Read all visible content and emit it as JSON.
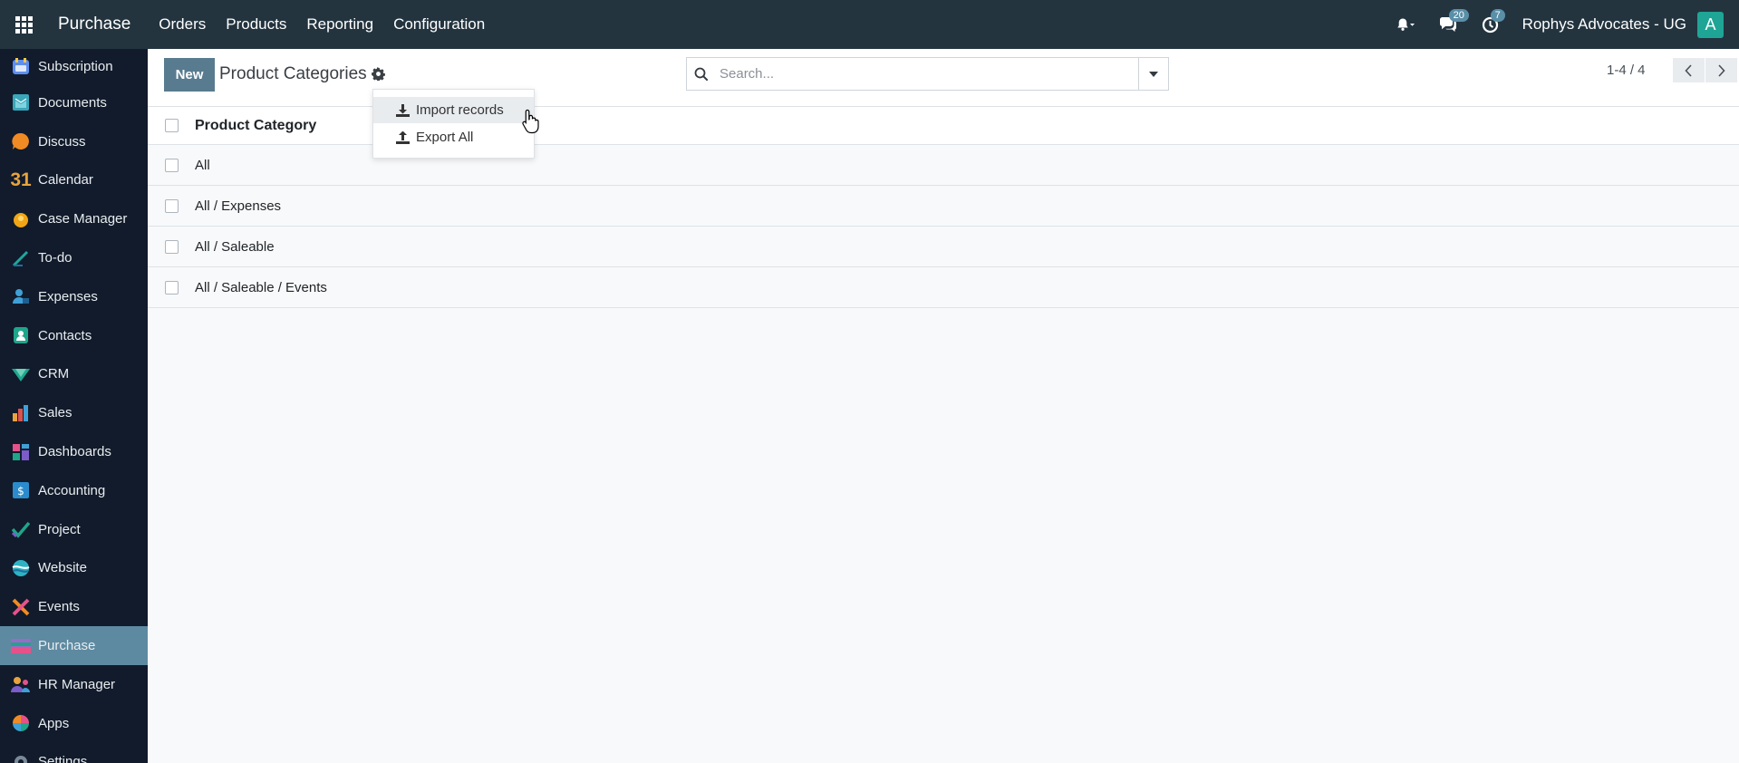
{
  "topbar": {
    "apps_icon": "grid-icon",
    "brand": "Purchase",
    "menu": [
      "Orders",
      "Products",
      "Reporting",
      "Configuration"
    ],
    "messages_count": "20",
    "activities_count": "7",
    "company": "Rophys Advocates - UG",
    "avatar_letter": "A",
    "avatar_color": "#1ea596"
  },
  "sidebar": {
    "items": [
      {
        "label": "Subscription",
        "icon": "subscription-icon"
      },
      {
        "label": "Documents",
        "icon": "documents-icon"
      },
      {
        "label": "Discuss",
        "icon": "discuss-icon"
      },
      {
        "label": "Calendar",
        "icon": "calendar-icon"
      },
      {
        "label": "Case Manager",
        "icon": "case-manager-icon"
      },
      {
        "label": "To-do",
        "icon": "todo-icon"
      },
      {
        "label": "Expenses",
        "icon": "expenses-icon"
      },
      {
        "label": "Contacts",
        "icon": "contacts-icon"
      },
      {
        "label": "CRM",
        "icon": "crm-icon"
      },
      {
        "label": "Sales",
        "icon": "sales-icon"
      },
      {
        "label": "Dashboards",
        "icon": "dashboards-icon"
      },
      {
        "label": "Accounting",
        "icon": "accounting-icon"
      },
      {
        "label": "Project",
        "icon": "project-icon"
      },
      {
        "label": "Website",
        "icon": "website-icon"
      },
      {
        "label": "Events",
        "icon": "events-icon"
      },
      {
        "label": "Purchase",
        "icon": "purchase-icon",
        "active": true
      },
      {
        "label": "HR Manager",
        "icon": "hr-manager-icon"
      },
      {
        "label": "Apps",
        "icon": "apps-icon"
      },
      {
        "label": "Settings",
        "icon": "settings-icon"
      }
    ],
    "calendar_glyph": "31"
  },
  "control_panel": {
    "new_label": "New",
    "title": "Product Categories",
    "search_placeholder": "Search...",
    "pager": "1-4 / 4"
  },
  "actions_menu": {
    "items": [
      {
        "label": "Import records",
        "icon": "download-icon"
      },
      {
        "label": "Export All",
        "icon": "upload-icon"
      }
    ]
  },
  "list": {
    "column_header": "Product Category",
    "rows": [
      "All",
      "All / Expenses",
      "All / Saleable",
      "All / Saleable / Events"
    ]
  }
}
